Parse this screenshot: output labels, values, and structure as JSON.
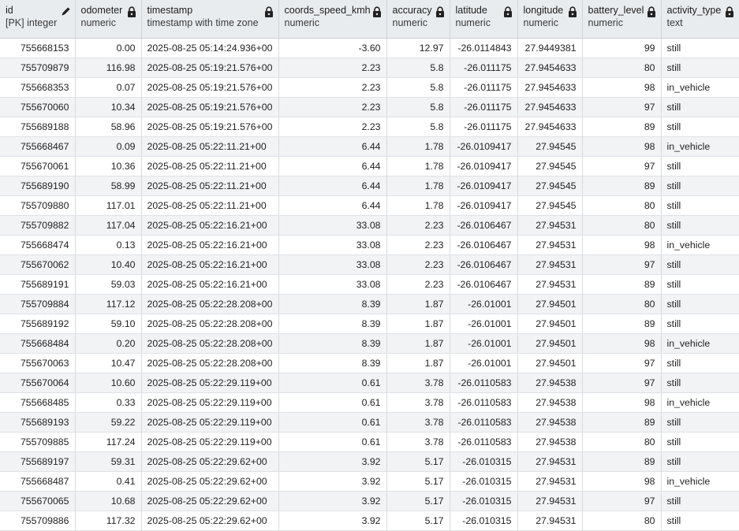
{
  "columns": [
    {
      "name": "id",
      "type": "[PK] integer",
      "icon": "pencil-icon"
    },
    {
      "name": "odometer",
      "type": "numeric",
      "icon": "lock-icon"
    },
    {
      "name": "timestamp",
      "type": "timestamp with time zone",
      "icon": "lock-icon"
    },
    {
      "name": "coords_speed_kmh",
      "type": "numeric",
      "icon": "lock-icon"
    },
    {
      "name": "accuracy",
      "type": "numeric",
      "icon": "lock-icon"
    },
    {
      "name": "latitude",
      "type": "numeric",
      "icon": "lock-icon"
    },
    {
      "name": "longitude",
      "type": "numeric",
      "icon": "lock-icon"
    },
    {
      "name": "battery_level",
      "type": "numeric",
      "icon": "lock-icon"
    },
    {
      "name": "activity_type",
      "type": "text",
      "icon": "lock-icon"
    }
  ],
  "rows": [
    [
      "755668153",
      "0.00",
      "2025-08-25 05:14:24.936+00",
      "-3.60",
      "12.97",
      "-26.0114843",
      "27.9449381",
      "99",
      "still"
    ],
    [
      "755709879",
      "116.98",
      "2025-08-25 05:19:21.576+00",
      "2.23",
      "5.8",
      "-26.011175",
      "27.9454633",
      "80",
      "still"
    ],
    [
      "755668353",
      "0.07",
      "2025-08-25 05:19:21.576+00",
      "2.23",
      "5.8",
      "-26.011175",
      "27.9454633",
      "98",
      "in_vehicle"
    ],
    [
      "755670060",
      "10.34",
      "2025-08-25 05:19:21.576+00",
      "2.23",
      "5.8",
      "-26.011175",
      "27.9454633",
      "97",
      "still"
    ],
    [
      "755689188",
      "58.96",
      "2025-08-25 05:19:21.576+00",
      "2.23",
      "5.8",
      "-26.011175",
      "27.9454633",
      "89",
      "still"
    ],
    [
      "755668467",
      "0.09",
      "2025-08-25 05:22:11.21+00",
      "6.44",
      "1.78",
      "-26.0109417",
      "27.94545",
      "98",
      "in_vehicle"
    ],
    [
      "755670061",
      "10.36",
      "2025-08-25 05:22:11.21+00",
      "6.44",
      "1.78",
      "-26.0109417",
      "27.94545",
      "97",
      "still"
    ],
    [
      "755689190",
      "58.99",
      "2025-08-25 05:22:11.21+00",
      "6.44",
      "1.78",
      "-26.0109417",
      "27.94545",
      "89",
      "still"
    ],
    [
      "755709880",
      "117.01",
      "2025-08-25 05:22:11.21+00",
      "6.44",
      "1.78",
      "-26.0109417",
      "27.94545",
      "80",
      "still"
    ],
    [
      "755709882",
      "117.04",
      "2025-08-25 05:22:16.21+00",
      "33.08",
      "2.23",
      "-26.0106467",
      "27.94531",
      "80",
      "still"
    ],
    [
      "755668474",
      "0.13",
      "2025-08-25 05:22:16.21+00",
      "33.08",
      "2.23",
      "-26.0106467",
      "27.94531",
      "98",
      "in_vehicle"
    ],
    [
      "755670062",
      "10.40",
      "2025-08-25 05:22:16.21+00",
      "33.08",
      "2.23",
      "-26.0106467",
      "27.94531",
      "97",
      "still"
    ],
    [
      "755689191",
      "59.03",
      "2025-08-25 05:22:16.21+00",
      "33.08",
      "2.23",
      "-26.0106467",
      "27.94531",
      "89",
      "still"
    ],
    [
      "755709884",
      "117.12",
      "2025-08-25 05:22:28.208+00",
      "8.39",
      "1.87",
      "-26.01001",
      "27.94501",
      "80",
      "still"
    ],
    [
      "755689192",
      "59.10",
      "2025-08-25 05:22:28.208+00",
      "8.39",
      "1.87",
      "-26.01001",
      "27.94501",
      "89",
      "still"
    ],
    [
      "755668484",
      "0.20",
      "2025-08-25 05:22:28.208+00",
      "8.39",
      "1.87",
      "-26.01001",
      "27.94501",
      "98",
      "in_vehicle"
    ],
    [
      "755670063",
      "10.47",
      "2025-08-25 05:22:28.208+00",
      "8.39",
      "1.87",
      "-26.01001",
      "27.94501",
      "97",
      "still"
    ],
    [
      "755670064",
      "10.60",
      "2025-08-25 05:22:29.119+00",
      "0.61",
      "3.78",
      "-26.0110583",
      "27.94538",
      "97",
      "still"
    ],
    [
      "755668485",
      "0.33",
      "2025-08-25 05:22:29.119+00",
      "0.61",
      "3.78",
      "-26.0110583",
      "27.94538",
      "98",
      "in_vehicle"
    ],
    [
      "755689193",
      "59.22",
      "2025-08-25 05:22:29.119+00",
      "0.61",
      "3.78",
      "-26.0110583",
      "27.94538",
      "89",
      "still"
    ],
    [
      "755709885",
      "117.24",
      "2025-08-25 05:22:29.119+00",
      "0.61",
      "3.78",
      "-26.0110583",
      "27.94538",
      "80",
      "still"
    ],
    [
      "755689197",
      "59.31",
      "2025-08-25 05:22:29.62+00",
      "3.92",
      "5.17",
      "-26.010315",
      "27.94531",
      "89",
      "still"
    ],
    [
      "755668487",
      "0.41",
      "2025-08-25 05:22:29.62+00",
      "3.92",
      "5.17",
      "-26.010315",
      "27.94531",
      "98",
      "in_vehicle"
    ],
    [
      "755670065",
      "10.68",
      "2025-08-25 05:22:29.62+00",
      "3.92",
      "5.17",
      "-26.010315",
      "27.94531",
      "97",
      "still"
    ],
    [
      "755709886",
      "117.32",
      "2025-08-25 05:22:29.62+00",
      "3.92",
      "5.17",
      "-26.010315",
      "27.94531",
      "80",
      "still"
    ]
  ]
}
